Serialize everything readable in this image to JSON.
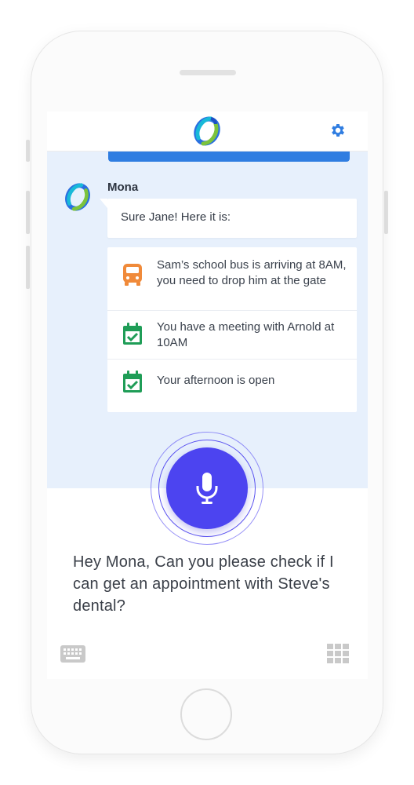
{
  "header": {
    "logo_icon": "app-logo-ring-icon",
    "settings_icon": "gear-icon",
    "accent_color": "#2f7de1"
  },
  "conversation": {
    "sender": "Mona",
    "avatar_icon": "app-logo-ring-icon",
    "reply": "Sure Jane! Here it is:",
    "schedule": [
      {
        "icon": "bus-icon",
        "icon_color": "#f08a3a",
        "text": "Sam’s school bus is arriving at 8AM, you need to drop him at the gate"
      },
      {
        "icon": "calendar-check-icon",
        "icon_color": "#1f9d57",
        "text": "You have a meeting with Arnold at 10AM"
      },
      {
        "icon": "calendar-check-icon",
        "icon_color": "#1f9d57",
        "text": "Your afternoon is open"
      }
    ]
  },
  "voice": {
    "mic_icon": "microphone-icon",
    "mic_color": "#4c44f0",
    "transcript": "Hey Mona, Can you please check if I can get an appointment with Steve's dental?"
  },
  "footer": {
    "keyboard_icon": "keyboard-icon",
    "grid_icon": "grid-icon"
  }
}
